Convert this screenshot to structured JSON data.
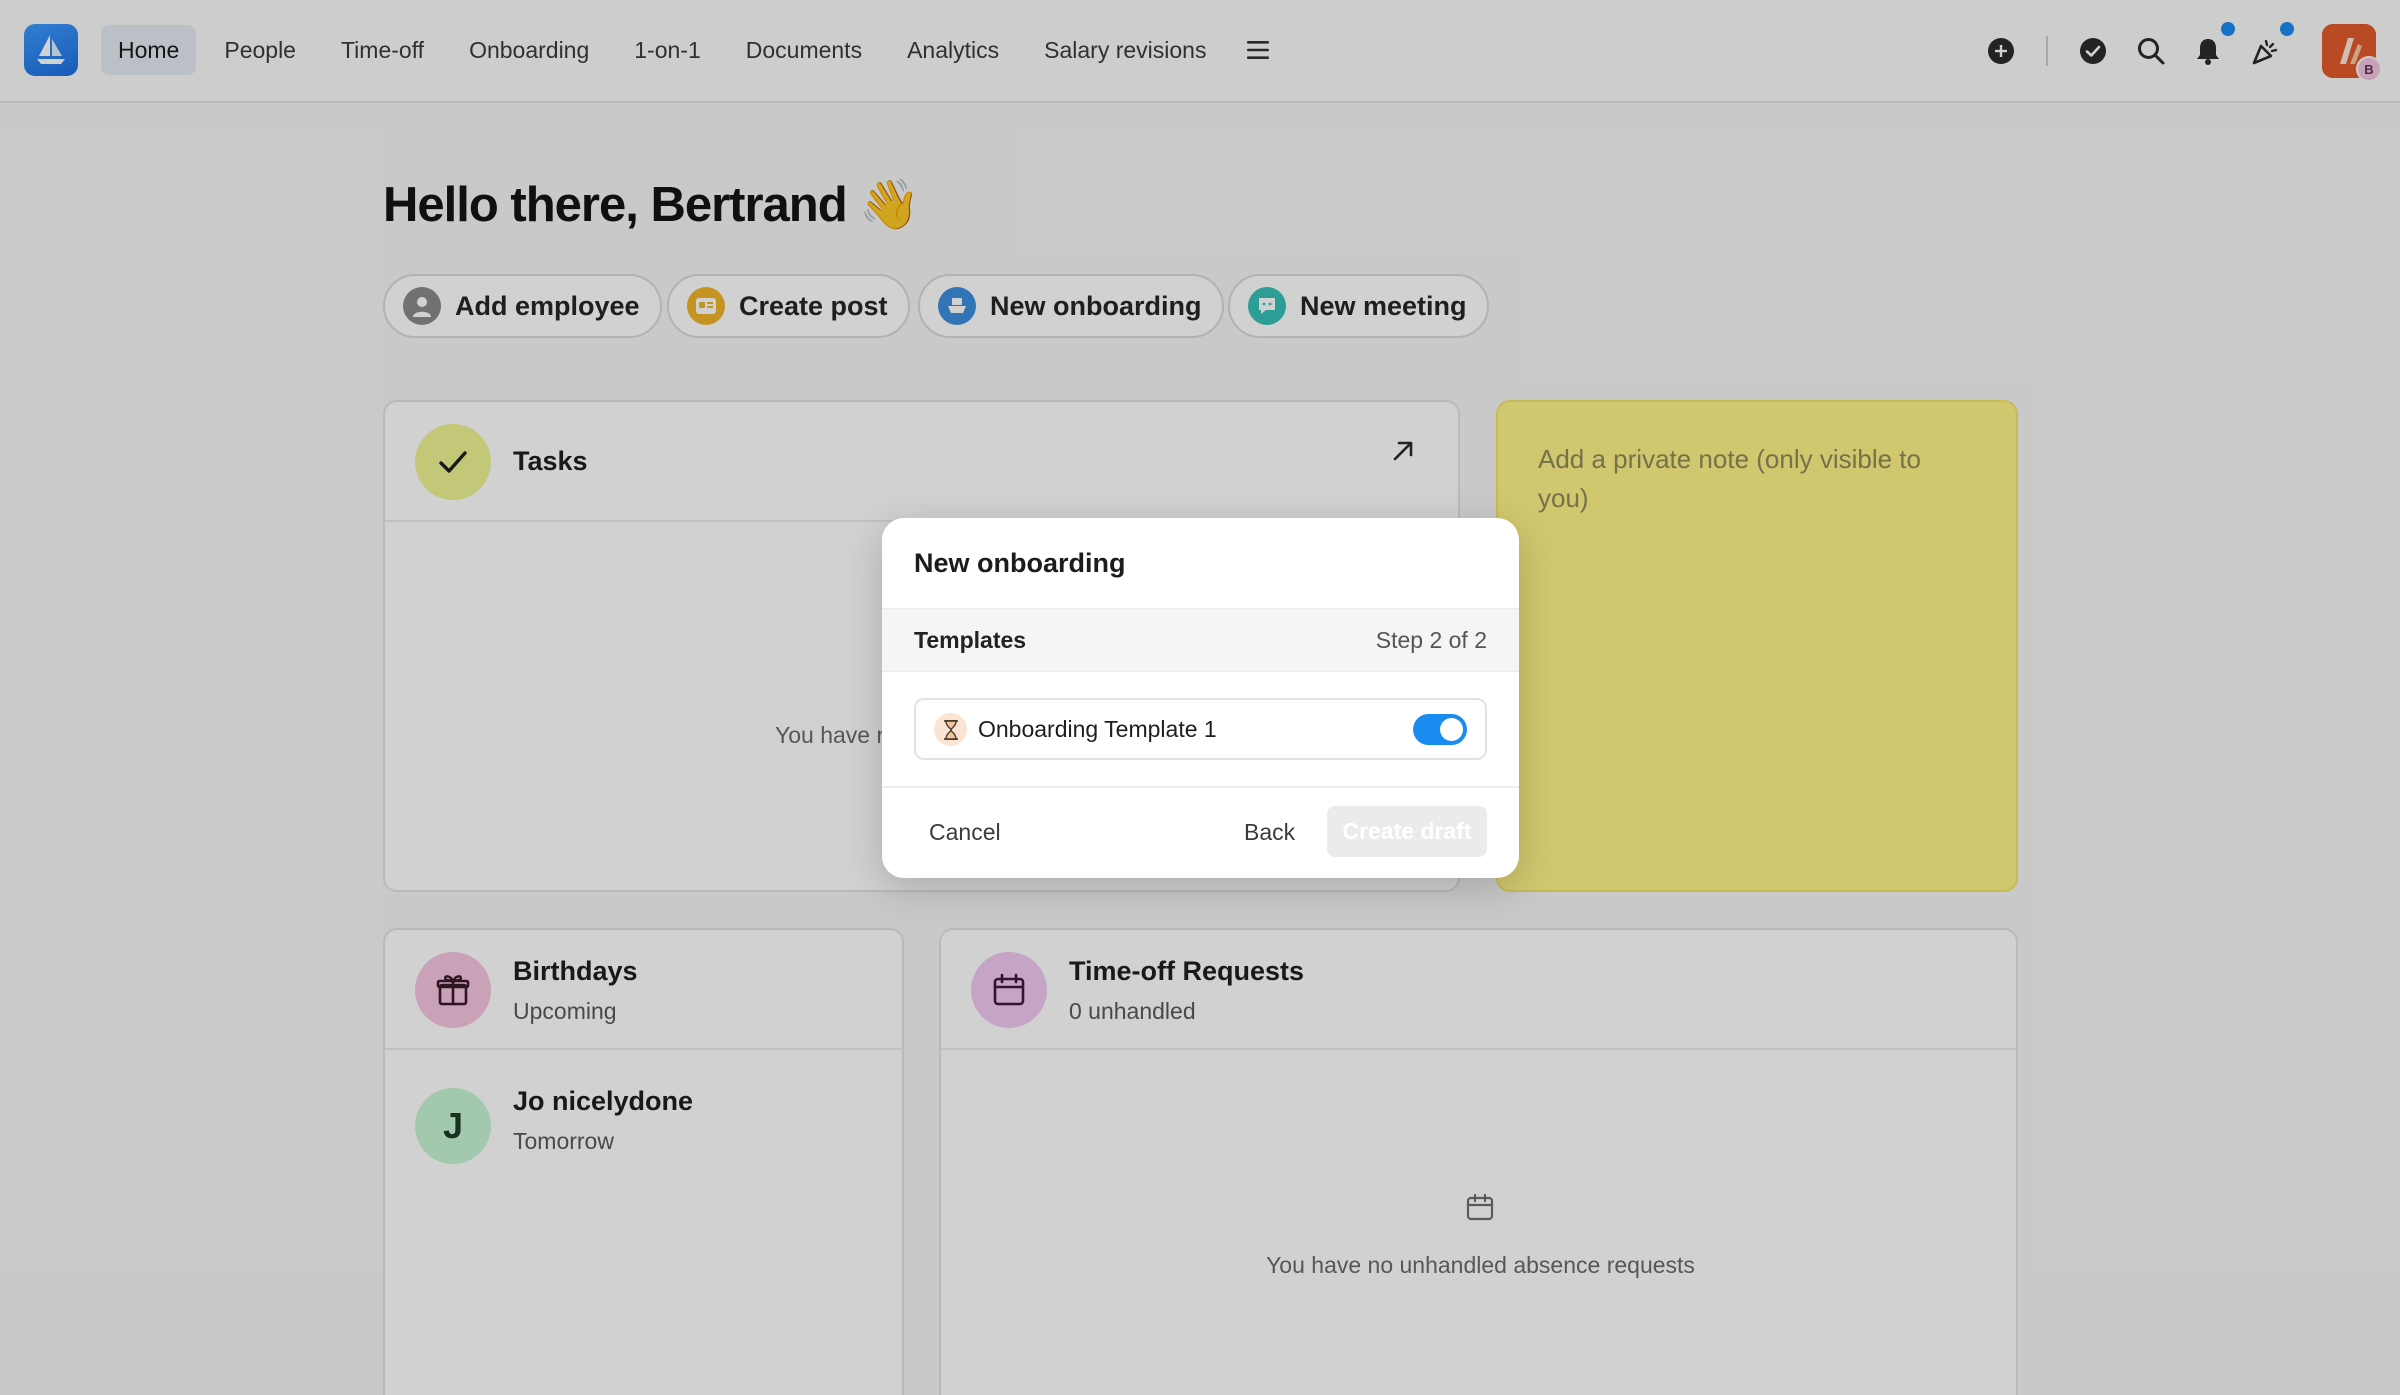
{
  "nav": {
    "items": [
      {
        "label": "Home",
        "active": true
      },
      {
        "label": "People"
      },
      {
        "label": "Time-off"
      },
      {
        "label": "Onboarding"
      },
      {
        "label": "1-on-1"
      },
      {
        "label": "Documents"
      },
      {
        "label": "Analytics"
      },
      {
        "label": "Salary revisions"
      }
    ],
    "menu_icon": "hamburger-icon",
    "actions": [
      "plus-circle-icon",
      "check-circle-icon",
      "search-icon",
      "bell-icon",
      "party-popper-icon"
    ],
    "avatar_badge": "B",
    "accent": "#1a8cf0"
  },
  "greeting": "Hello there, Bertrand 👋",
  "quick_actions": {
    "add_employee": "Add employee",
    "create_post": "Create post",
    "new_onboarding": "New onboarding",
    "new_meeting": "New meeting"
  },
  "tasks": {
    "title": "Tasks",
    "empty_text": "You have r"
  },
  "note": {
    "placeholder": "Add a private note (only visible to you)",
    "color": "#fff388"
  },
  "birthdays": {
    "title": "Birthdays",
    "subtitle": "Upcoming",
    "people": [
      {
        "initial": "J",
        "name": "Jo nicelydone",
        "when": "Tomorrow"
      }
    ]
  },
  "timeoff": {
    "title": "Time-off Requests",
    "subtitle": "0 unhandled",
    "empty_text": "You have no unhandled absence requests"
  },
  "modal": {
    "title": "New onboarding",
    "section_label": "Templates",
    "step": "Step 2 of 2",
    "template": {
      "name": "Onboarding Template 1",
      "enabled": true
    },
    "cancel_label": "Cancel",
    "back_label": "Back",
    "create_label": "Create draft"
  }
}
